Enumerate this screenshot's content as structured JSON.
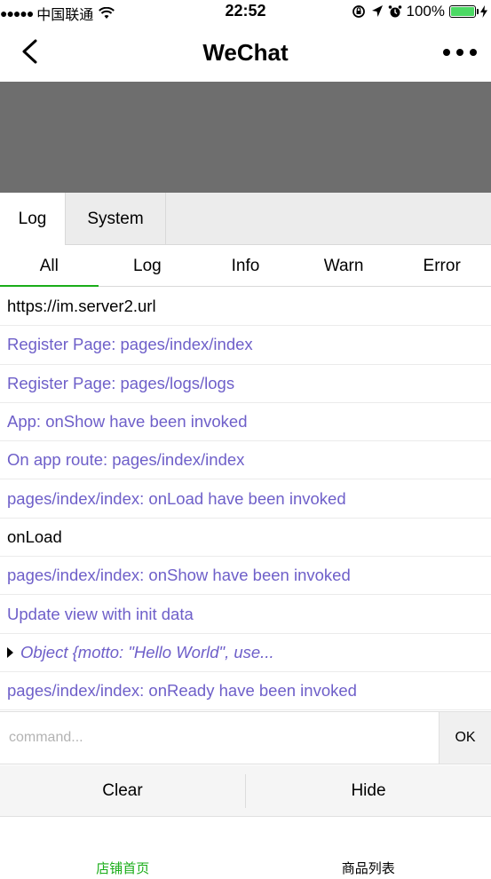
{
  "status_bar": {
    "signal_dots": "●●●●●",
    "carrier": "中国联通",
    "time": "22:52",
    "battery_percent": "100%",
    "battery_level": 1.0
  },
  "nav": {
    "title": "WeChat"
  },
  "console": {
    "top_tabs": [
      "Log",
      "System"
    ],
    "active_top_tab": "Log",
    "sub_tabs": [
      "All",
      "Log",
      "Info",
      "Warn",
      "Error"
    ],
    "active_sub_tab": "All",
    "logs": [
      {
        "text": "https://im.server2.url",
        "type": "plain"
      },
      {
        "text": "Register Page: pages/index/index",
        "type": "info"
      },
      {
        "text": "Register Page: pages/logs/logs",
        "type": "info"
      },
      {
        "text": "App: onShow have been invoked",
        "type": "info"
      },
      {
        "text": "On app route: pages/index/index",
        "type": "info"
      },
      {
        "text": "pages/index/index: onLoad have been invoked",
        "type": "info"
      },
      {
        "text": "onLoad",
        "type": "plain"
      },
      {
        "text": "pages/index/index: onShow have been invoked",
        "type": "info"
      },
      {
        "text": "Update view with init data",
        "type": "info"
      },
      {
        "text": "Object {motto: \"Hello World\", use...",
        "type": "obj"
      },
      {
        "text": "pages/index/index: onReady have been invoked",
        "type": "info"
      }
    ],
    "command_placeholder": "command...",
    "ok_label": "OK",
    "clear_label": "Clear",
    "hide_label": "Hide"
  },
  "tab_bar": {
    "items": [
      "店铺首页",
      "商品列表"
    ],
    "active_index": 0
  },
  "colors": {
    "accent": "#1aad19",
    "info_text": "#6e5fc9",
    "overlay": "#6e6e6e",
    "battery": "#4cd964"
  }
}
